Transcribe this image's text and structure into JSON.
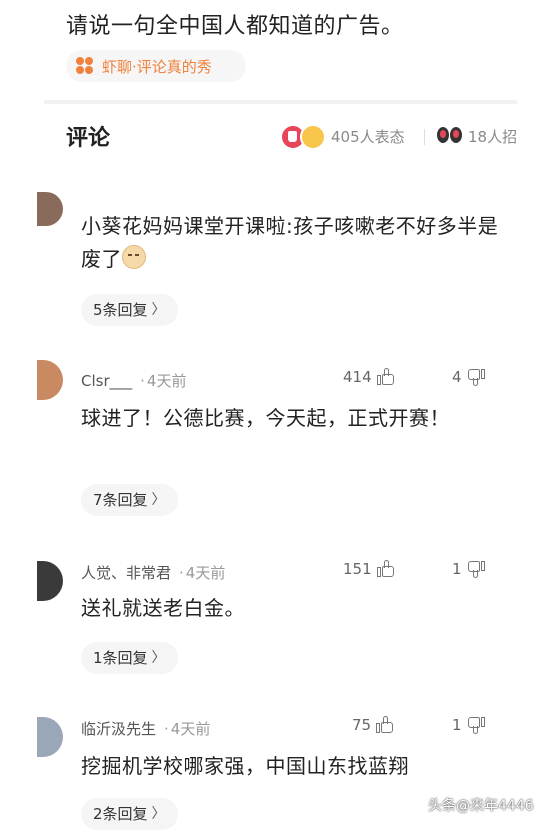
{
  "question": {
    "title": "请说一句全中国人都知道的广告。"
  },
  "source": {
    "label": "虾聊·评论真的秀"
  },
  "comments_header": {
    "title": "评论",
    "reactions_text": "405人表态",
    "views_text": "18人招"
  },
  "comments": [
    {
      "author": "",
      "time": "",
      "text": "小葵花妈妈课堂开课啦:孩子咳嗽老不好多半是废了",
      "likes": "",
      "dislikes": "",
      "replies_label": "5条回复",
      "avatar_color": "#8a6a5a"
    },
    {
      "author": "Clsr___",
      "time": "4天前",
      "text": "球进了！公德比赛，今天起，正式开赛！",
      "likes": "414",
      "dislikes": "4",
      "replies_label": "7条回复",
      "avatar_color": "#c98a62"
    },
    {
      "author": "人觉、非常君",
      "time": "4天前",
      "text": "送礼就送老白金。",
      "likes": "151",
      "dislikes": "1",
      "replies_label": "1条回复",
      "avatar_color": "#3a3a3a"
    },
    {
      "author": "临沂汲先生",
      "time": "4天前",
      "text": "挖掘机学校哪家强，中国山东找蓝翔",
      "likes": "75",
      "dislikes": "1",
      "replies_label": "2条回复",
      "avatar_color": "#9aa7b8"
    }
  ],
  "watermark": "头条@来年4446",
  "icons": {
    "source": "clover-icon",
    "reactions": "reaction-emoji-icon",
    "views": "eyes-icon",
    "like": "thumbs-up-icon",
    "dislike": "thumbs-down-icon",
    "replies_chevron": "chevron-right-icon"
  }
}
